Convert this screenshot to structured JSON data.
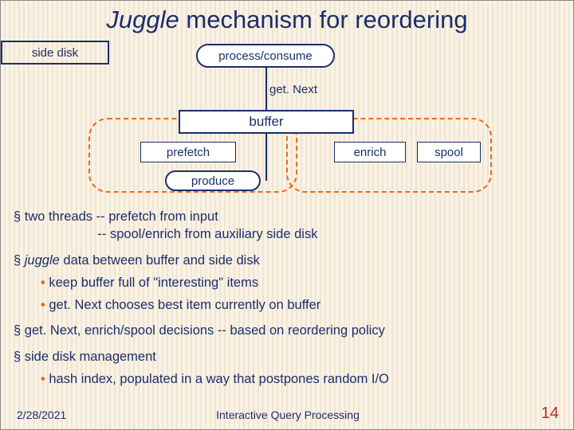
{
  "title_italic": "Juggle",
  "title_rest": " mechanism for reordering",
  "diagram": {
    "process_consume": "process/consume",
    "get_next": "get. Next",
    "buffer": "buffer",
    "prefetch": "prefetch",
    "enrich": "enrich",
    "spool": "spool",
    "produce": "produce",
    "side_disk": "side disk"
  },
  "bullets": {
    "b1a": "two threads -- prefetch from input",
    "b1b": "                       -- spool/enrich from auxiliary side disk",
    "b2_it": "juggle",
    "b2_rest": " data between buffer and side disk",
    "b2s1": "keep buffer full of \"interesting\" items",
    "b2s2": "get. Next chooses best item currently on buffer",
    "b3": "get. Next, enrich/spool decisions -- based on reordering policy",
    "b4": "side disk management",
    "b4s1": "hash index, populated in a way that postpones random I/O"
  },
  "footer": {
    "date": "2/28/2021",
    "center": "Interactive Query Processing",
    "page": "14"
  }
}
